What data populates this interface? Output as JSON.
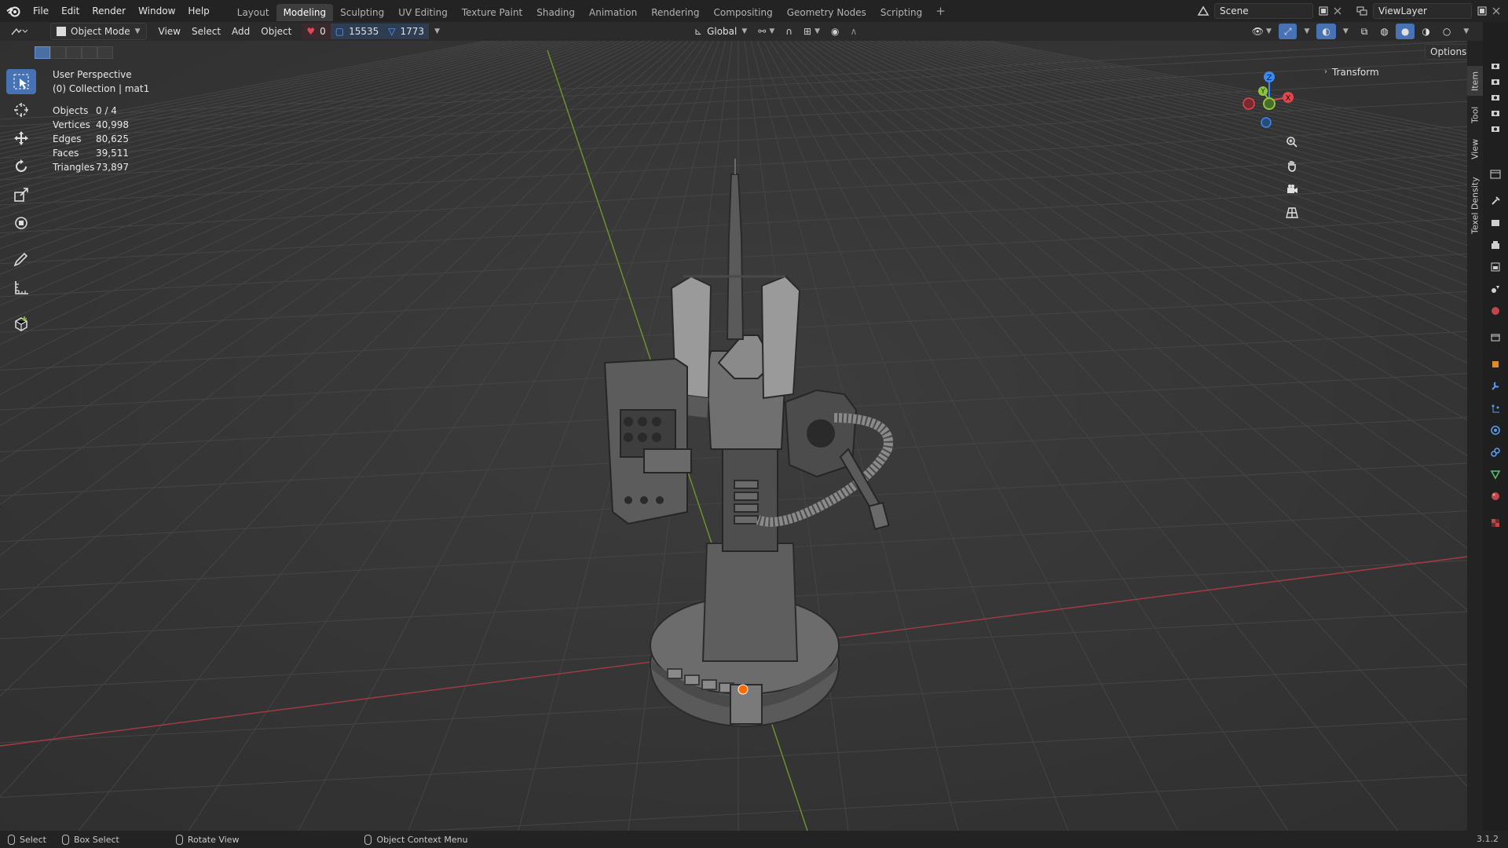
{
  "topbar": {
    "menu": [
      "File",
      "Edit",
      "Render",
      "Window",
      "Help"
    ],
    "tabs": [
      "Layout",
      "Modeling",
      "Sculpting",
      "UV Editing",
      "Texture Paint",
      "Shading",
      "Animation",
      "Rendering",
      "Compositing",
      "Geometry Nodes",
      "Scripting"
    ],
    "active_tab": "Modeling",
    "add_tab": "+",
    "scene_name": "Scene",
    "viewlayer_name": "ViewLayer"
  },
  "header": {
    "mode": "Object Mode",
    "menus": [
      "View",
      "Select",
      "Add",
      "Object"
    ],
    "counter_a": "0",
    "counter_b": "15535",
    "counter_c": "1773",
    "orientation": "Global"
  },
  "viewport": {
    "view_name": "User Perspective",
    "collection": "(0) Collection | mat1",
    "stats": [
      {
        "label": "Objects",
        "value": "0 / 4"
      },
      {
        "label": "Vertices",
        "value": "40,998"
      },
      {
        "label": "Edges",
        "value": "80,625"
      },
      {
        "label": "Faces",
        "value": "39,511"
      },
      {
        "label": "Triangles",
        "value": "73,897"
      }
    ],
    "options_label": "Options",
    "npanel_transform": "Transform",
    "gizmo_labels": {
      "x": "X",
      "y": "Y",
      "z": "Z"
    }
  },
  "side_tabs": [
    "Item",
    "Tool",
    "View",
    "Texel Density"
  ],
  "statusbar": {
    "select": "Select",
    "box_select": "Box Select",
    "rotate_view": "Rotate View",
    "context_menu": "Object Context Menu",
    "version": "3.1.2"
  },
  "colors": {
    "accent": "#4772b3",
    "axis_x": "#e0474f",
    "axis_y": "#8cc63f",
    "axis_z": "#3a8bf0"
  },
  "icons": {
    "logo": "blender-logo-icon",
    "zoom": "zoom-icon",
    "pan": "hand-icon",
    "camera": "camera-icon",
    "perspective": "grid-view-icon"
  }
}
